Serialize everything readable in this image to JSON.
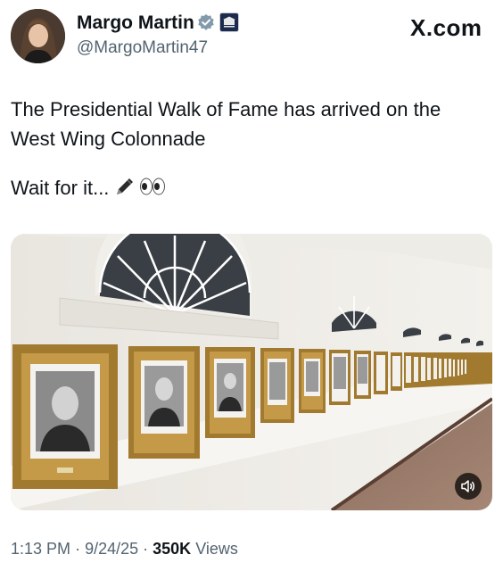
{
  "author": {
    "name": "Margo Martin",
    "handle": "@MargoMartin47",
    "avatar_icon": "profile-photo-icon",
    "verified_icon": "verified-badge-icon",
    "affiliation_icon": "white-house-affiliation-icon"
  },
  "brand": "X.com",
  "tweet": {
    "line1": "The Presidential Walk of Fame has arrived on the",
    "line2": "West Wing Colonnade",
    "line3": "Wait for it...",
    "emoji": [
      "pen-icon",
      "eyes-icon"
    ]
  },
  "media": {
    "type": "video",
    "sound_icon": "speaker-muted-icon"
  },
  "meta": {
    "time": "1:13 PM",
    "date": "9/24/25",
    "views_count": "350K",
    "views_label": "Views"
  },
  "colors": {
    "text": "#0f1419",
    "secondary": "#536471",
    "verified": "#829aab"
  }
}
